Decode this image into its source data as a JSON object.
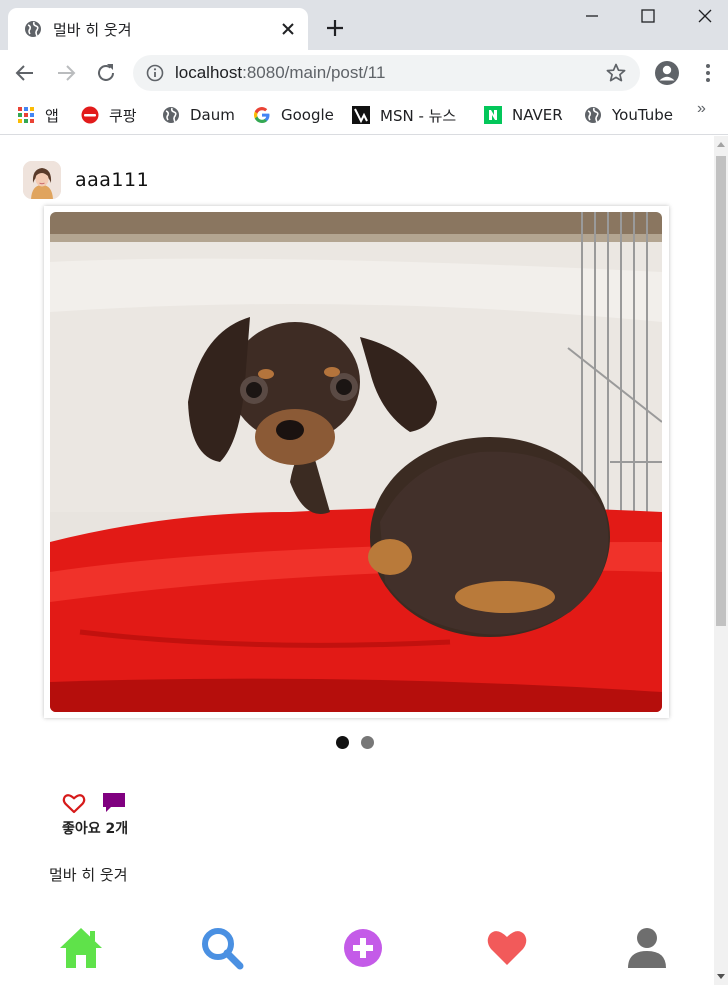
{
  "browser": {
    "tab_title": "멀바 히 웃겨",
    "url_host": "localhost",
    "url_path": ":8080/main/post/11",
    "bookmarks": [
      {
        "label": "앱",
        "icon": "apps-grid-icon"
      },
      {
        "label": "쿠팡",
        "icon": "coupang-icon"
      },
      {
        "label": "Daum",
        "icon": "globe-icon"
      },
      {
        "label": "Google",
        "icon": "google-icon"
      },
      {
        "label": "MSN - 뉴스",
        "icon": "msn-icon"
      },
      {
        "label": "NAVER",
        "icon": "naver-icon"
      },
      {
        "label": "YouTube",
        "icon": "globe-icon"
      }
    ],
    "more_bookmarks": "»"
  },
  "post": {
    "username": "aaa111",
    "image_count": 2,
    "active_image": 1,
    "likes_text": "좋아요 2개",
    "caption": "멀바 히 웃겨"
  },
  "nav": [
    {
      "name": "home",
      "icon": "home-icon",
      "color": "#5fe24a"
    },
    {
      "name": "search",
      "icon": "search-icon",
      "color": "#4a90e2"
    },
    {
      "name": "add",
      "icon": "add-circle-icon",
      "color": "#c45be8"
    },
    {
      "name": "likes",
      "icon": "heart-icon",
      "color": "#f25a5a"
    },
    {
      "name": "profile",
      "icon": "user-icon",
      "color": "#6e6e6e"
    }
  ],
  "colors": {
    "like_outline": "#d61a1a",
    "comment": "#800080",
    "chrome_bg": "#dee1e6"
  }
}
